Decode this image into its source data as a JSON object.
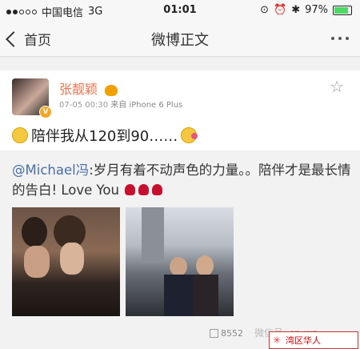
{
  "status": {
    "carrier": "中国电信",
    "network": "3G",
    "time": "01:01",
    "battery": "97%",
    "battery_level": 0.97
  },
  "nav": {
    "back_label": "首页",
    "title": "微博正文"
  },
  "post": {
    "username": "张靓颖",
    "time": "07-05 00:30",
    "source": "来自 iPhone 6 Plus",
    "text": "陪伴我从120到90……"
  },
  "repost": {
    "mention": "@Michael冯",
    "text": ":岁月有着不动声色的力量。。陪伴才是最长情的告白! Love You"
  },
  "footer": {
    "count": "8552",
    "watermark": "微信号: sz_wz",
    "badge": "湾区华人"
  }
}
